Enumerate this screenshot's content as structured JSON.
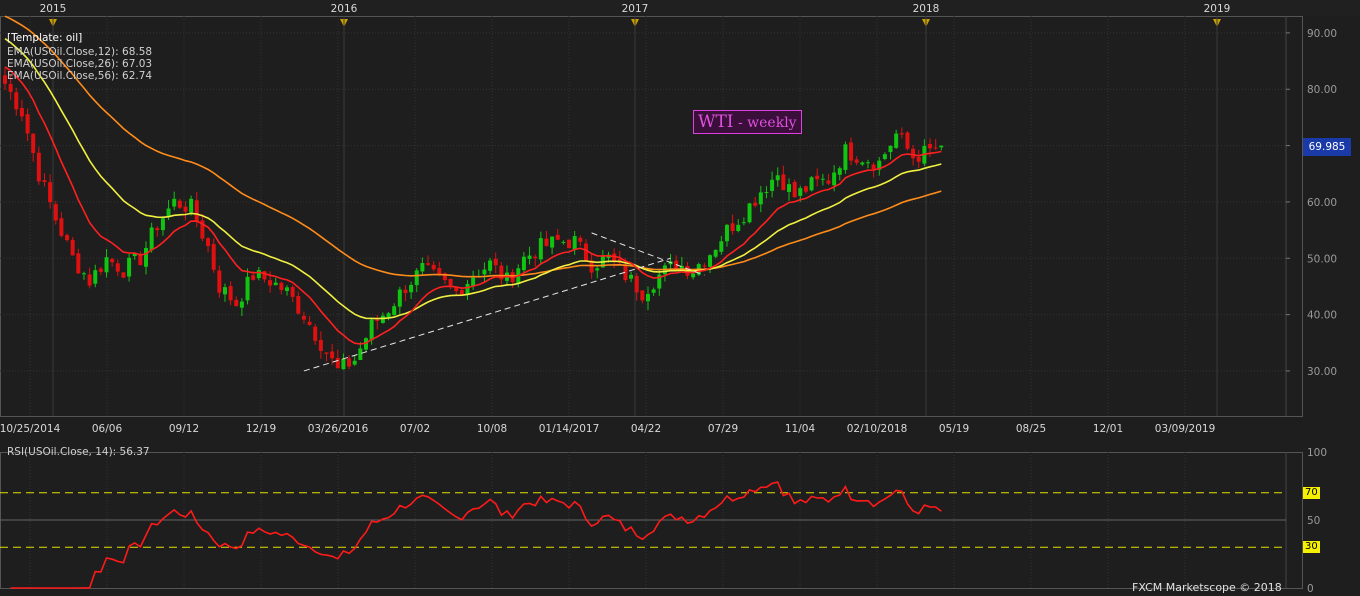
{
  "template_label": "[Template: oil]",
  "title": {
    "main": "WTI",
    "sub": " - weekly"
  },
  "footer": "FXCM Marketscope © 2018",
  "last_price_label": "69.985",
  "colors": {
    "bg": "#1e1e1e",
    "up": "#11c411",
    "down": "#e01010",
    "ema12": "#ff2020",
    "ema26": "#f0f040",
    "ema56": "#ff8c1a",
    "rsi": "#ff1a1a",
    "grid": "#333333",
    "level": "#e0e000",
    "badge": "#1a3aa8"
  },
  "legend": [
    {
      "text": "EMA(USOil.Close,12): 68.58",
      "color": "#ff3030"
    },
    {
      "text": "EMA(USOil.Close,26): 67.03",
      "color": "#f0f040"
    },
    {
      "text": "EMA(USOil.Close,56): 62.74",
      "color": "#ff8c1a"
    }
  ],
  "rsi_label": "RSI(USOil.Close, 14): 56.37",
  "rsi_levels": [
    {
      "label": "70",
      "value": 70
    },
    {
      "label": "50",
      "value": 50
    },
    {
      "label": "30",
      "value": 30
    }
  ],
  "chart_data": [
    {
      "type": "candlestick",
      "x_labels": [
        "10/25/2014",
        "06/06",
        "09/12",
        "12/19",
        "03/26/2016",
        "07/02",
        "10/08",
        "01/14/2017",
        "04/22",
        "07/29",
        "11/04",
        "02/10/2018",
        "05/19",
        "08/25",
        "12/01",
        "03/09/2019"
      ],
      "year_labels": [
        "2015",
        "2016",
        "2017",
        "2018",
        "2019"
      ],
      "y_ticks": [
        "90.00",
        "80.00",
        "70.00",
        "60.00",
        "50.00",
        "40.00",
        "30.00"
      ],
      "ylim": [
        22,
        93
      ],
      "grid": true,
      "close_anchors": [
        {
          "week": 0,
          "close": 81
        },
        {
          "week": 3,
          "close": 76
        },
        {
          "week": 6,
          "close": 65
        },
        {
          "week": 9,
          "close": 57
        },
        {
          "week": 12,
          "close": 50
        },
        {
          "week": 15,
          "close": 46
        },
        {
          "week": 18,
          "close": 50
        },
        {
          "week": 21,
          "close": 48
        },
        {
          "week": 24,
          "close": 50
        },
        {
          "week": 27,
          "close": 56
        },
        {
          "week": 30,
          "close": 60
        },
        {
          "week": 33,
          "close": 59
        },
        {
          "week": 36,
          "close": 52
        },
        {
          "week": 38,
          "close": 45
        },
        {
          "week": 41,
          "close": 42
        },
        {
          "week": 44,
          "close": 47
        },
        {
          "week": 47,
          "close": 46
        },
        {
          "week": 50,
          "close": 44
        },
        {
          "week": 53,
          "close": 40
        },
        {
          "week": 56,
          "close": 35
        },
        {
          "week": 59,
          "close": 30
        },
        {
          "week": 62,
          "close": 32
        },
        {
          "week": 65,
          "close": 38
        },
        {
          "week": 68,
          "close": 41
        },
        {
          "week": 71,
          "close": 45
        },
        {
          "week": 74,
          "close": 48
        },
        {
          "week": 77,
          "close": 46
        },
        {
          "week": 80,
          "close": 44
        },
        {
          "week": 83,
          "close": 47
        },
        {
          "week": 86,
          "close": 49
        },
        {
          "week": 89,
          "close": 46
        },
        {
          "week": 92,
          "close": 50
        },
        {
          "week": 95,
          "close": 52
        },
        {
          "week": 98,
          "close": 53
        },
        {
          "week": 101,
          "close": 53
        },
        {
          "week": 104,
          "close": 49
        },
        {
          "week": 107,
          "close": 50
        },
        {
          "week": 110,
          "close": 47
        },
        {
          "week": 113,
          "close": 44
        },
        {
          "week": 116,
          "close": 47
        },
        {
          "week": 119,
          "close": 49
        },
        {
          "week": 122,
          "close": 48
        },
        {
          "week": 125,
          "close": 51
        },
        {
          "week": 128,
          "close": 55
        },
        {
          "week": 131,
          "close": 58
        },
        {
          "week": 134,
          "close": 62
        },
        {
          "week": 137,
          "close": 65
        },
        {
          "week": 140,
          "close": 61
        },
        {
          "week": 143,
          "close": 63
        },
        {
          "week": 146,
          "close": 64
        },
        {
          "week": 149,
          "close": 69
        },
        {
          "week": 152,
          "close": 68
        },
        {
          "week": 155,
          "close": 67
        },
        {
          "week": 158,
          "close": 72
        },
        {
          "week": 161,
          "close": 68
        },
        {
          "week": 164,
          "close": 69
        },
        {
          "week": 166,
          "close": 69.985
        }
      ],
      "ema_final": {
        "ema12": 68.58,
        "ema26": 67.03,
        "ema56": 62.74
      }
    },
    {
      "type": "line",
      "name": "RSI(USOil.Close, 14)",
      "ylim": [
        0,
        100
      ],
      "y_ticks": [
        "100",
        "70",
        "50",
        "30",
        "0"
      ],
      "last_value": 56.37
    }
  ]
}
